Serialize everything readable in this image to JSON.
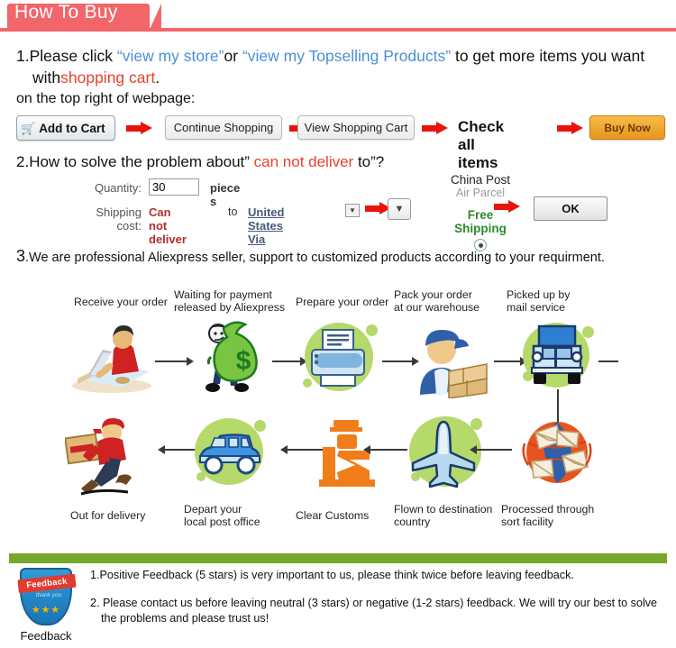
{
  "header": {
    "title": "How To Buy",
    "accent_color": "#f2666a"
  },
  "step1": {
    "number": "1.",
    "text_a": "Please click ",
    "link1": "“view my store”",
    "text_b": "or ",
    "link2": "“view my Topselling Products”",
    "text_c": " to get  more items you want",
    "text_d": "with ",
    "highlight": "shopping cart",
    "text_e": ".",
    "subtitle": "on the top right of webpage:",
    "link_color": "#4a90d9",
    "highlight_color": "#e8422e"
  },
  "buttons": {
    "add_to_cart": "Add to Cart",
    "cart_icon": "shopping-cart-icon",
    "continue_shopping": "Continue Shopping",
    "view_shopping_cart": "View Shopping Cart",
    "check_all_items": "Check all items",
    "buy_now": "Buy Now",
    "buy_now_color": "#e8951c",
    "arrow_color": "#e8140c"
  },
  "step2": {
    "number": "2.",
    "text_a": "How to solve the problem about” ",
    "highlight": "can not deliver",
    "text_b": " to”?",
    "form": {
      "quantity_label": "Quantity:",
      "quantity_value": "30",
      "quantity_unit": "piece s",
      "shipping_label": "Shipping cost:",
      "shipping_status": "Can not deliver",
      "shipping_to": "to",
      "shipping_country": "United States Via",
      "dropdown_icon": "chevron-down-icon"
    },
    "carrier": {
      "name": "China Post",
      "sub": "Air Parcel",
      "free_shipping": "Free\nShipping",
      "free_shipping_color": "#2d8a2d",
      "radio_selected": true
    },
    "ok_button": "OK"
  },
  "step3": {
    "number": "3",
    "text": ".We are professional Aliexpress seller, support to customized products according to your requirment."
  },
  "flow": {
    "row1": [
      {
        "label": "Receive your order",
        "icon": "person-at-computer-icon"
      },
      {
        "label": "Waiting for payment\nreleased by Aliexpress",
        "icon": "money-bag-icon"
      },
      {
        "label": "Prepare your order",
        "icon": "printer-icon"
      },
      {
        "label": "Pack your order\nat our warehouse",
        "icon": "worker-packing-boxes-icon"
      },
      {
        "label": "Picked up by\nmail service",
        "icon": "delivery-truck-icon"
      }
    ],
    "row2": [
      {
        "label": "Out for delivery",
        "icon": "running-courier-icon"
      },
      {
        "label": "Depart your\nlocal post office",
        "icon": "postal-van-icon"
      },
      {
        "label": "Clear Customs",
        "icon": "customs-officer-icon"
      },
      {
        "label": "Flown to destination\ncountry",
        "icon": "airplane-icon"
      },
      {
        "label": "Processed through\nsort facility",
        "icon": "mail-sorting-globe-icon"
      }
    ]
  },
  "feedback": {
    "bar_color": "#76a82b",
    "badge": {
      "ribbon": "Feedback",
      "sub": "thank you",
      "stars": "★★★",
      "caption": "Feedback"
    },
    "lines": [
      "1.Positive Feedback (5 stars) is very important to us, please think twice before leaving feedback.",
      "2. Please contact us before leaving neutral (3 stars) or negative (1-2 stars) feedback. We will try our best to solve",
      "the problems and please trust us!"
    ]
  }
}
